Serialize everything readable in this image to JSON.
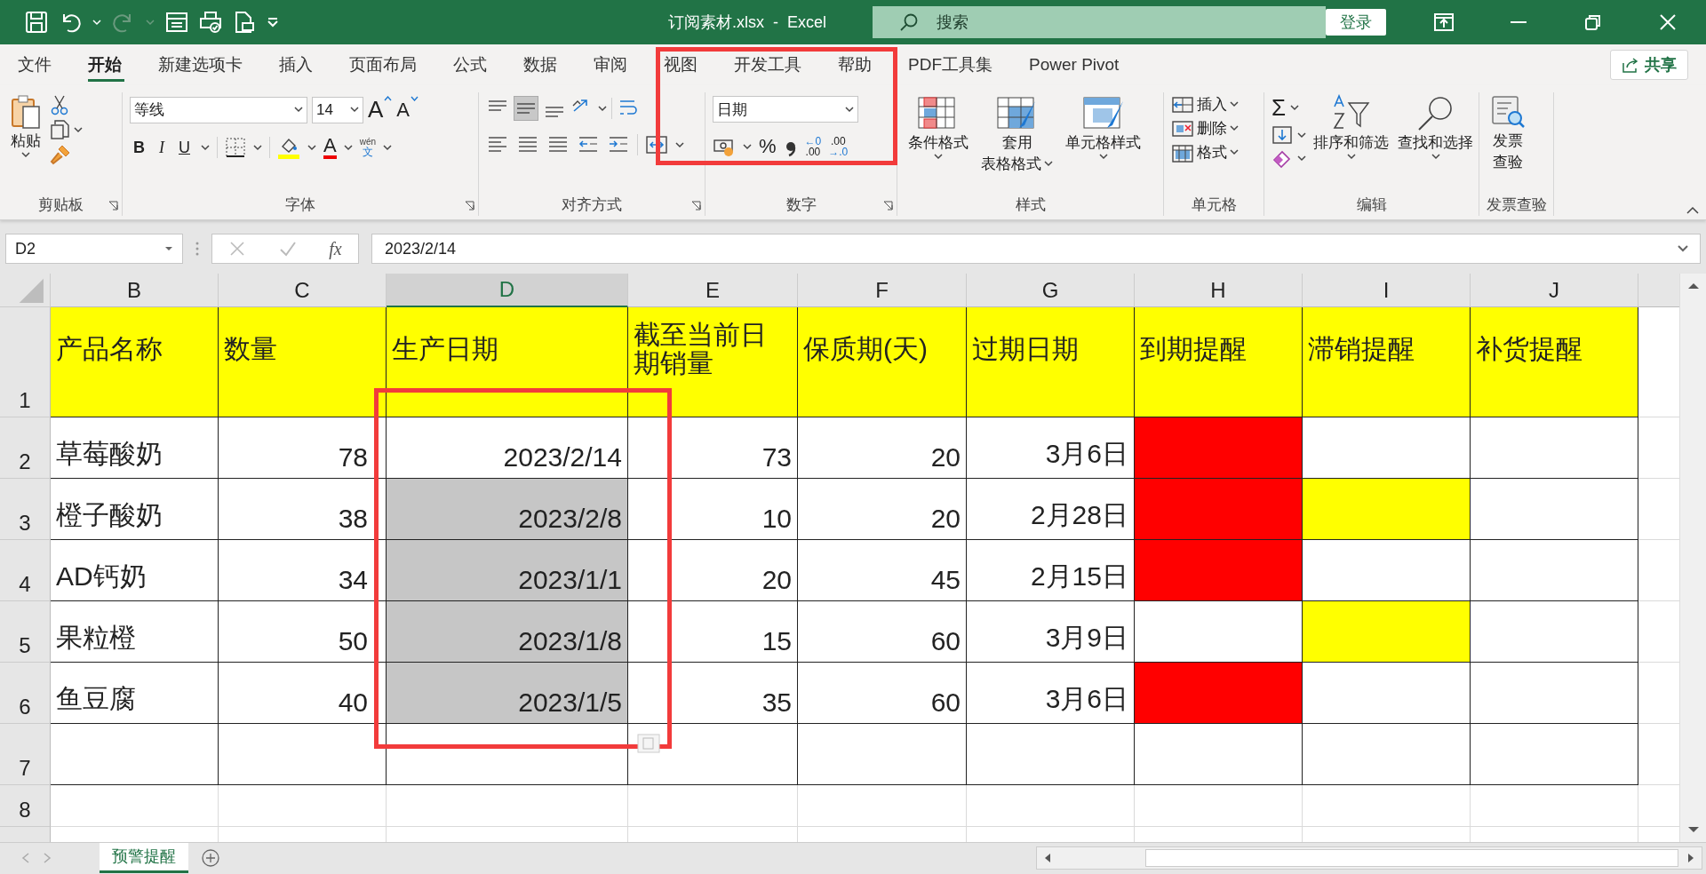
{
  "title_bar": {
    "title": "订阅素材.xlsx  -  Excel",
    "search": {
      "placeholder": "搜索"
    },
    "login": "登录"
  },
  "menu_tabs": [
    {
      "label": "文件",
      "selected": false
    },
    {
      "label": "开始",
      "selected": true
    },
    {
      "label": "新建选项卡",
      "selected": false
    },
    {
      "label": "插入",
      "selected": false
    },
    {
      "label": "页面布局",
      "selected": false
    },
    {
      "label": "公式",
      "selected": false
    },
    {
      "label": "数据",
      "selected": false
    },
    {
      "label": "审阅",
      "selected": false
    },
    {
      "label": "视图",
      "selected": false
    },
    {
      "label": "开发工具",
      "selected": false
    },
    {
      "label": "帮助",
      "selected": false
    },
    {
      "label": "PDF工具集",
      "selected": false
    },
    {
      "label": "Power Pivot",
      "selected": false
    }
  ],
  "share": "共享",
  "ribbon": [
    {
      "kind": "clipboard",
      "label": "剪贴板",
      "paste": "粘贴"
    },
    {
      "kind": "font",
      "label": "字体",
      "font": "等线",
      "size": "14",
      "grow": "A",
      "shrink": "A",
      "bold": "B",
      "italic": "I",
      "underline": "U",
      "font_color": "A",
      "phonetic": "wén",
      "phonetic_char": "文"
    },
    {
      "kind": "alignment",
      "label": "对齐方式"
    },
    {
      "kind": "number",
      "label": "数字",
      "format": "日期",
      "percent": "%",
      "increase_decimal": [
        "←0",
        ".00"
      ],
      "decrease_decimal": [
        ".00",
        "→.0"
      ],
      "outlined": true
    },
    {
      "kind": "styles",
      "label": "样式",
      "buttons": [
        [
          "条件格式"
        ],
        [
          "套用",
          "表格格式"
        ],
        [
          "单元格样式"
        ]
      ]
    },
    {
      "kind": "cells",
      "label": "单元格",
      "buttons": [
        "插入",
        "删除",
        "格式"
      ]
    },
    {
      "kind": "editing",
      "label": "编辑",
      "sum": "Σ",
      "buttons": [
        "排序和筛选",
        "查找和选择"
      ]
    },
    {
      "kind": "invoice",
      "label": "发票查验",
      "button": [
        "发票",
        "查验"
      ]
    }
  ],
  "formula_bar": {
    "name_box": "D2",
    "fx": "fx",
    "formula": "2023/2/14"
  },
  "sheet": {
    "columns": [
      {
        "label": "B",
        "selected": false
      },
      {
        "label": "C",
        "selected": false
      },
      {
        "label": "D",
        "selected": true,
        "outlined": true
      },
      {
        "label": "E",
        "selected": false
      },
      {
        "label": "F",
        "selected": false
      },
      {
        "label": "G",
        "selected": false
      },
      {
        "label": "H",
        "selected": false
      },
      {
        "label": "I",
        "selected": false
      },
      {
        "label": "J",
        "selected": false
      }
    ],
    "rows": [
      {
        "label": "1",
        "kind": "header",
        "cells": [
          {
            "text": "产品名称",
            "color": "#ffff00"
          },
          {
            "text": "数量",
            "color": "#ffff00"
          },
          {
            "text": "生产日期",
            "color": "#ffff00"
          },
          {
            "text": "截至当前日期销量",
            "color": "#ffff00"
          },
          {
            "text": "保质期(天)",
            "color": "#ffff00"
          },
          {
            "text": "过期日期",
            "color": "#ffff00"
          },
          {
            "text": "到期提醒",
            "color": "#ffff00"
          },
          {
            "text": "滞销提醒",
            "color": "#ffff00"
          },
          {
            "text": "补货提醒",
            "color": "#ffff00"
          }
        ]
      },
      {
        "label": "2",
        "kind": "data",
        "cells": [
          {
            "text": "草莓酸奶"
          },
          {
            "text": "78"
          },
          {
            "text": "2023/2/14",
            "selected": false
          },
          {
            "text": "73"
          },
          {
            "text": "20"
          },
          {
            "text": "3月6日"
          },
          {
            "color": "#ff0000"
          },
          {},
          {}
        ]
      },
      {
        "label": "3",
        "kind": "data",
        "cells": [
          {
            "text": "橙子酸奶"
          },
          {
            "text": "38"
          },
          {
            "text": "2023/2/8",
            "selected": true
          },
          {
            "text": "10"
          },
          {
            "text": "20"
          },
          {
            "text": "2月28日"
          },
          {
            "color": "#ff0000"
          },
          {
            "color": "#ffff00"
          },
          {}
        ]
      },
      {
        "label": "4",
        "kind": "data",
        "cells": [
          {
            "text": "AD钙奶"
          },
          {
            "text": "34"
          },
          {
            "text": "2023/1/1",
            "selected": true
          },
          {
            "text": "20"
          },
          {
            "text": "45"
          },
          {
            "text": "2月15日"
          },
          {
            "color": "#ff0000"
          },
          {},
          {}
        ]
      },
      {
        "label": "5",
        "kind": "data",
        "cells": [
          {
            "text": "果粒橙"
          },
          {
            "text": "50"
          },
          {
            "text": "2023/1/8",
            "selected": true
          },
          {
            "text": "15"
          },
          {
            "text": "60"
          },
          {
            "text": "3月9日"
          },
          {},
          {
            "color": "#ffff00"
          },
          {}
        ]
      },
      {
        "label": "6",
        "kind": "data",
        "cells": [
          {
            "text": "鱼豆腐"
          },
          {
            "text": "40"
          },
          {
            "text": "2023/1/5",
            "selected": true
          },
          {
            "text": "35"
          },
          {
            "text": "60"
          },
          {
            "text": "3月6日"
          },
          {
            "color": "#ff0000"
          },
          {},
          {}
        ]
      },
      {
        "label": "7",
        "kind": "data"
      },
      {
        "label": "8",
        "kind": "plain"
      }
    ]
  },
  "sheet_tabs": [
    {
      "label": "预警提醒",
      "selected": true
    }
  ]
}
